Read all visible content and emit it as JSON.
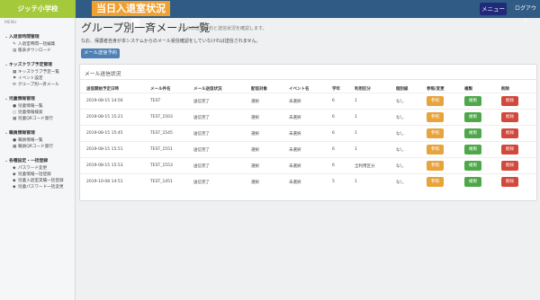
{
  "header": {
    "school_name": "ジッテ小学校",
    "page_banner": "当日入退室状況一覧",
    "menu_label": "メニュー",
    "logout_label": "ログアウト"
  },
  "sidebar": {
    "menu_label": "MENU",
    "sections": [
      {
        "title": "入退室時間管理",
        "items": [
          {
            "icon": "pencil-icon",
            "glyph": "✎",
            "label": "入退室時間一括編集"
          },
          {
            "icon": "download-icon",
            "glyph": "▤",
            "label": "帳表ダウンロード"
          }
        ]
      },
      {
        "title": "キッズクラブ予定管理",
        "items": [
          {
            "icon": "calendar-icon",
            "glyph": "▦",
            "label": "キッズクラブ予定一覧"
          },
          {
            "icon": "flag-icon",
            "glyph": "⚑",
            "label": "イベント設定"
          },
          {
            "icon": "mail-icon",
            "glyph": "✉",
            "label": "グループ別一斉メール"
          }
        ]
      },
      {
        "title": "児童情報管理",
        "items": [
          {
            "icon": "user-icon",
            "glyph": "●",
            "label": "児童情報一覧"
          },
          {
            "icon": "search-icon",
            "glyph": "○",
            "label": "児童情報検索"
          },
          {
            "icon": "qr-icon",
            "glyph": "▦",
            "label": "児童QRコード発行"
          }
        ]
      },
      {
        "title": "職員情報管理",
        "items": [
          {
            "icon": "staff-icon",
            "glyph": "●",
            "label": "職員情報一覧"
          },
          {
            "icon": "qr-icon",
            "glyph": "▦",
            "label": "職員QRコード発行"
          }
        ]
      },
      {
        "title": "各種設定・一括登録",
        "items": [
          {
            "icon": "key-icon",
            "glyph": "◆",
            "label": "パスワード変更"
          },
          {
            "icon": "upload-icon",
            "glyph": "◆",
            "label": "児童情報一括登録"
          },
          {
            "icon": "upload-icon",
            "glyph": "◆",
            "label": "児童入退室実績一括登録"
          },
          {
            "icon": "key-icon",
            "glyph": "◆",
            "label": "児童パスワード一括変更"
          }
        ]
      }
    ]
  },
  "main": {
    "title": "グループ別一斉メール一覧",
    "subtitle": "メールの送信予約と送信状況を確認します。",
    "notice": "なお、保護者自身が本システムからのメール受信確認をしていなければ送信されません。",
    "schedule_button": "メール送信予約",
    "panel_title": "メール送信状況",
    "columns": [
      "送信開始予定日時",
      "メール件名",
      "メール送信状況",
      "配信対象",
      "イベント名",
      "学年",
      "利用区分",
      "個別級",
      "参照/変更",
      "複製",
      "削除"
    ],
    "rows": [
      {
        "date": "2019-08-15 14:56",
        "name": "TEST",
        "status": "送信完了",
        "target": "選択",
        "event": "未選択",
        "grade": "6",
        "category": "1",
        "cls": "なし"
      },
      {
        "date": "2019-08-15 15:21",
        "name": "TEST_1503",
        "status": "送信完了",
        "target": "選択",
        "event": "未選択",
        "grade": "6",
        "category": "1",
        "cls": "なし"
      },
      {
        "date": "2019-08-15 15:45",
        "name": "TEST_1545",
        "status": "送信完了",
        "target": "選択",
        "event": "未選択",
        "grade": "6",
        "category": "1",
        "cls": "なし"
      },
      {
        "date": "2019-08-15 15:51",
        "name": "TEST_1551",
        "status": "送信完了",
        "target": "選択",
        "event": "未選択",
        "grade": "6",
        "category": "1",
        "cls": "なし"
      },
      {
        "date": "2019-08-15 15:53",
        "name": "TEST_1553",
        "status": "送信完了",
        "target": "選択",
        "event": "未選択",
        "grade": "6",
        "category": "全利用区分",
        "cls": "なし"
      },
      {
        "date": "2019-10-08 14:51",
        "name": "TEST_1451",
        "status": "送信完了",
        "target": "選択",
        "event": "未選択",
        "grade": "5",
        "category": "1",
        "cls": "なし"
      }
    ],
    "row_buttons": {
      "ref": "参照",
      "copy": "複製",
      "del": "削除"
    }
  },
  "colors": {
    "header_bg": "#2f5b84",
    "brand_bg": "#a4c93a",
    "banner_bg": "#f0a030",
    "menu_button_bg": "#1f2a7a",
    "ref_button": "#e8a33a",
    "copy_button": "#4ea84a",
    "delete_button": "#d2483b",
    "primary_button": "#4e80b5"
  }
}
